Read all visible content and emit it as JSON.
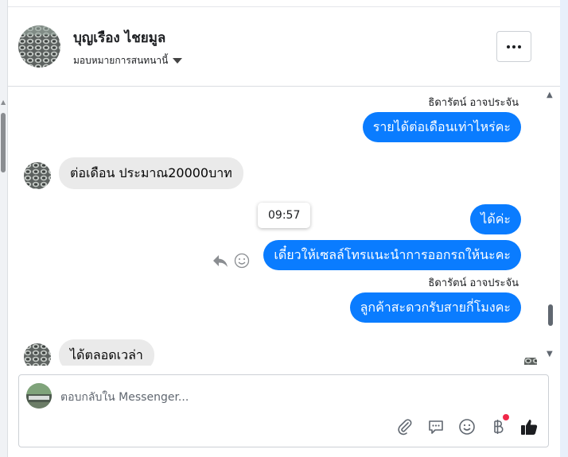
{
  "header": {
    "title": "บุญเรือง ไชยมูล",
    "subtitle": "มอบหมายการสนทนานี้"
  },
  "messages": [
    {
      "sender": "ธิดารัตน์ อาจประจัน",
      "text": "รายได้ต่อเดือนเท่าไหร่คะ"
    },
    {
      "text": "ต่อเดือน ประมาณ20000บาท"
    },
    {
      "text": "ได้ค่ะ"
    },
    {
      "text": "เดี๋ยวให้เซลล์โทรแนะนำการออกรถให้นะคะ"
    },
    {
      "sender": "ธิดารัตน์ อาจประจัน",
      "text": "ลูกค้าสะดวกรับสายกี่โมงคะ"
    },
    {
      "text": "ได้ตลอดเวล่า"
    }
  ],
  "tooltip": {
    "time": "09:57"
  },
  "composer": {
    "placeholder": "ตอบกลับใน Messenger..."
  },
  "icons": [
    "more-icon",
    "caret-down-icon",
    "reply-icon",
    "smile-icon",
    "attach-icon",
    "saved-reply-icon",
    "emoji-icon",
    "baht-icon",
    "thumbs-up-icon"
  ],
  "colors": {
    "outgoing_bubble": "#0a7cff",
    "incoming_bubble": "#eaeaea",
    "notification_dot": "#f02849"
  }
}
